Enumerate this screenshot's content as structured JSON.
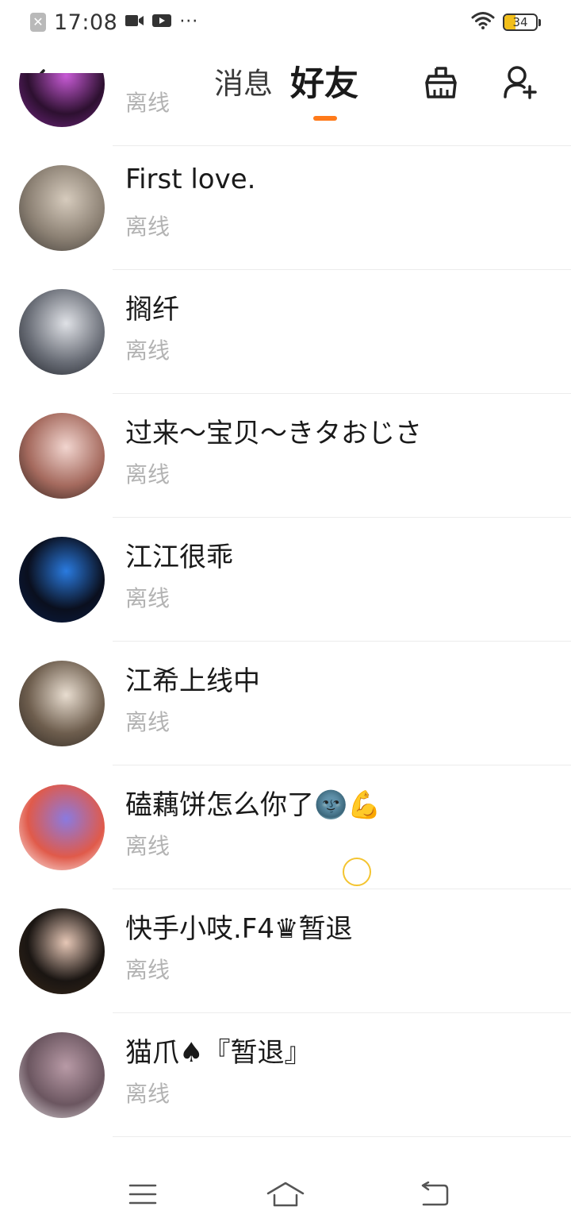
{
  "status_bar": {
    "time": "17:08",
    "dots": "···",
    "battery_level": "34",
    "icons": [
      "close-notification-icon",
      "video-camera-icon",
      "video-play-icon",
      "wifi-icon",
      "battery-icon"
    ]
  },
  "header": {
    "tabs": [
      {
        "label": "消息",
        "active": false
      },
      {
        "label": "好友",
        "active": true
      }
    ],
    "accent_color": "#ff7a1a",
    "icons": [
      "back-chevron-icon",
      "clean-brush-icon",
      "add-friend-icon"
    ]
  },
  "friends": [
    {
      "name": "",
      "status": "离线",
      "avatar_colors": [
        "#7a2a8c",
        "#c85bd6",
        "#2d1030"
      ]
    },
    {
      "name": "First love.",
      "status": "离线",
      "avatar_colors": [
        "#3e3a36",
        "#d6cbbd",
        "#8c8174"
      ]
    },
    {
      "name": "搁纤",
      "status": "离线",
      "avatar_colors": [
        "#1c1f26",
        "#dfe1e6",
        "#6b6f78"
      ]
    },
    {
      "name": "过来～宝贝～きタおじさ",
      "status": "离线",
      "avatar_colors": [
        "#2a1e1a",
        "#f1d5cf",
        "#a56a5e"
      ]
    },
    {
      "name": "江江很乖",
      "status": "离线",
      "avatar_colors": [
        "#0b1f4a",
        "#2a7be0",
        "#0a0f1e"
      ]
    },
    {
      "name": "江希上线中",
      "status": "离线",
      "avatar_colors": [
        "#2b2520",
        "#e8ddd0",
        "#6e5e4e"
      ]
    },
    {
      "name": "磕藕饼怎么你了🌚💪",
      "status": "离线",
      "avatar_colors": [
        "#ffffff",
        "#8a7ae0",
        "#e05a4a"
      ]
    },
    {
      "name": "快手小吱.F4♛暂退",
      "status": "离线",
      "avatar_colors": [
        "#3a2a1a",
        "#e6c7b6",
        "#1a1512"
      ]
    },
    {
      "name": "猫爪♠『暂退』",
      "status": "离线",
      "avatar_colors": [
        "#e8e3e6",
        "#b89aa6",
        "#6b5660"
      ]
    }
  ],
  "nav_bar": {
    "icons": [
      "menu-icon",
      "home-icon",
      "back-icon"
    ]
  }
}
